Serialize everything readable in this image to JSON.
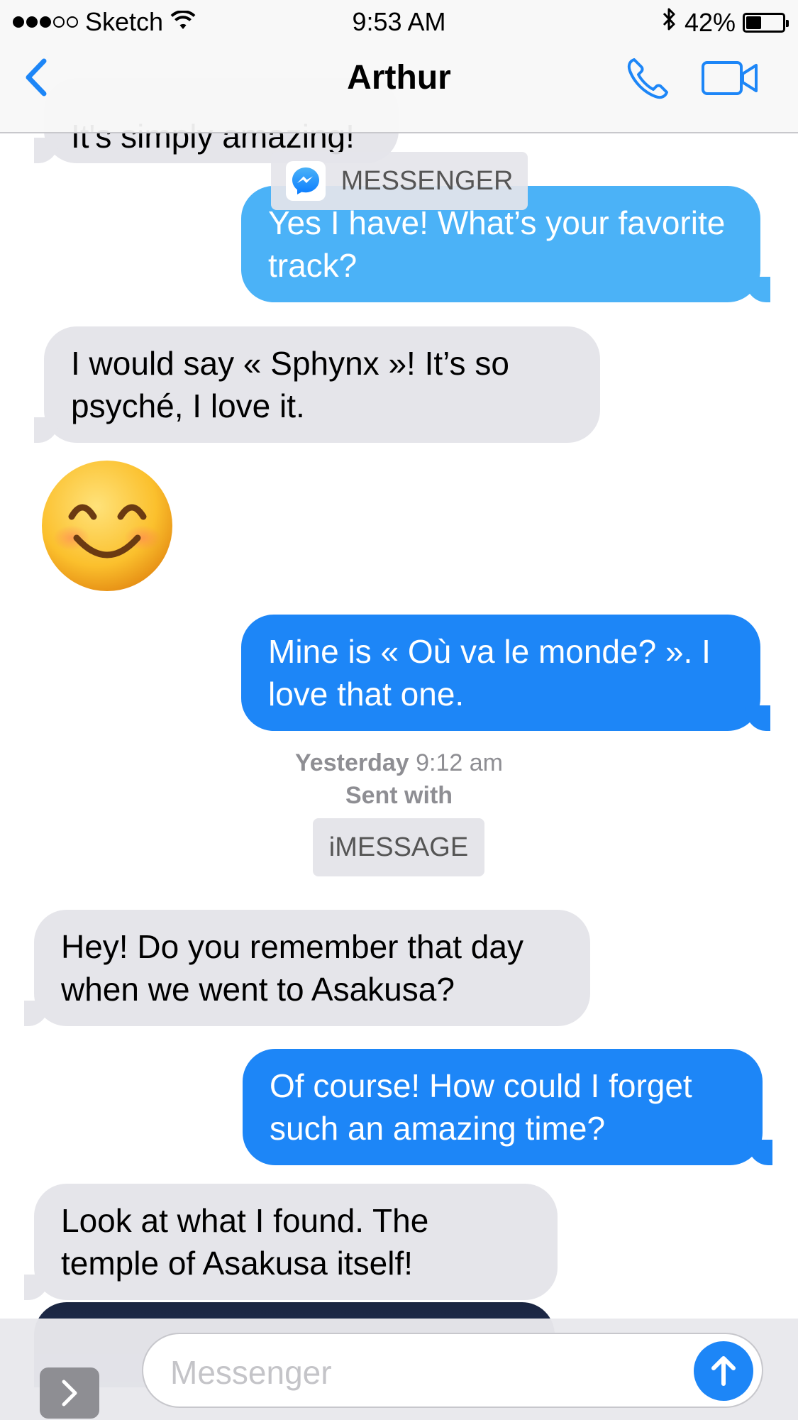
{
  "status_bar": {
    "carrier": "Sketch",
    "time": "9:53 AM",
    "battery": "42%",
    "battery_level": 0.42
  },
  "nav": {
    "title": "Arthur",
    "icons": [
      "chevron-left-icon",
      "phone-icon",
      "video-camera-icon"
    ]
  },
  "messages": {
    "m0_text": "It's simply amazing!",
    "m1_text": "Yes I have! What’s your favorite track?",
    "m2_text": "I would say « Sphynx »! It’s so psyché, I love it.",
    "m3_emoji": "smiling-face-emoji",
    "m4_text": "Mine is « Où va le monde? ». I love that one.",
    "m5_text": "Hey! Do you remember that day when we went to Asakusa?",
    "m6_text": "Of course! How could I forget such an amazing time?",
    "m7_text": "Look at what I found. The temple of Asakusa itself!"
  },
  "service_labels": {
    "messenger": "MESSENGER",
    "imessage": "iMESSAGE"
  },
  "divider": {
    "day": "Yesterday",
    "time": "9:12 am",
    "sent_with": "Sent with"
  },
  "composer": {
    "placeholder": "Messenger"
  },
  "colors": {
    "messenger_bubble": "#4bb2f7",
    "imessage_bubble": "#1d86f7",
    "incoming_bubble": "#e5e5ea",
    "accent": "#1d86f7"
  }
}
